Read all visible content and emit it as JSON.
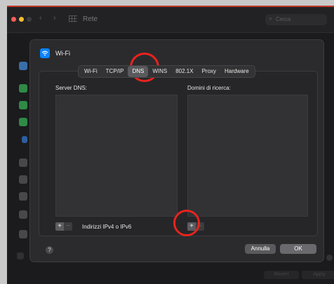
{
  "window": {
    "title": "Rete",
    "search_placeholder": "Cerca",
    "nav_back": "‹",
    "nav_forward": "›"
  },
  "dialog": {
    "title": "Wi-Fi",
    "tabs": [
      {
        "label": "Wi-Fi",
        "active": false
      },
      {
        "label": "TCP/IP",
        "active": false
      },
      {
        "label": "DNS",
        "active": true
      },
      {
        "label": "WINS",
        "active": false
      },
      {
        "label": "802.1X",
        "active": false
      },
      {
        "label": "Proxy",
        "active": false
      },
      {
        "label": "Hardware",
        "active": false
      }
    ],
    "dns_servers_label": "Server DNS:",
    "search_domains_label": "Domini di ricerca:",
    "plus": "+",
    "minus": "−",
    "dns_hint": "Indirizzi IPv4 o IPv6",
    "help": "?",
    "cancel_label": "Annulla",
    "ok_label": "OK"
  },
  "background_buttons": [
    "Revert",
    "Apply"
  ],
  "colors": {
    "accent": "#0a84ff",
    "annotation": "#e8231e",
    "window_bg": "#1b1b1d",
    "dialog_bg": "#2b2b2d"
  },
  "icons": {
    "dialog": "wifi-icon",
    "sidebar": [
      "wifi-icon",
      "phone-icon",
      "phone-icon",
      "phone-icon",
      "network-icon",
      "dots-icon",
      "dots-icon",
      "dots-icon",
      "dots-icon",
      "lock-icon"
    ]
  }
}
